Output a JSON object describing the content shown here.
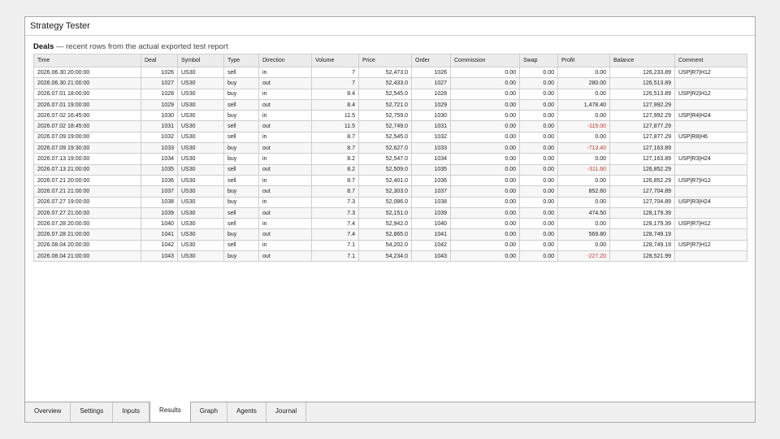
{
  "window": {
    "title": "Strategy Tester"
  },
  "section": {
    "title": "Deals",
    "description": " — recent rows from the actual exported test report"
  },
  "columns": [
    "Time",
    "Deal",
    "Symbol",
    "Type",
    "Direction",
    "Volume",
    "Price",
    "Order",
    "Commission",
    "Swap",
    "Profit",
    "Balance",
    "Comment"
  ],
  "rows": [
    [
      "2026.06.30 20:00:00",
      "1026",
      "US30",
      "sell",
      "in",
      "7",
      "52,473.0",
      "1026",
      "0.00",
      "0.00",
      "0.00",
      "126,233.89",
      "USP|R7|H12"
    ],
    [
      "2026.06.30 21:00:00",
      "1027",
      "US30",
      "buy",
      "out",
      "7",
      "52,433.0",
      "1027",
      "0.00",
      "0.00",
      "280.00",
      "126,513.89",
      ""
    ],
    [
      "2026.07.01 18:00:00",
      "1028",
      "US30",
      "buy",
      "in",
      "8.4",
      "52,545.0",
      "1028",
      "0.00",
      "0.00",
      "0.00",
      "126,513.89",
      "USP|R2|H12"
    ],
    [
      "2026.07.01 19:00:00",
      "1029",
      "US30",
      "sell",
      "out",
      "8.4",
      "52,721.0",
      "1029",
      "0.00",
      "0.00",
      "1,478.40",
      "127,992.29",
      ""
    ],
    [
      "2026.07.02 16:45:00",
      "1030",
      "US30",
      "buy",
      "in",
      "11.5",
      "52,759.0",
      "1030",
      "0.00",
      "0.00",
      "0.00",
      "127,992.29",
      "USP|R4|H24"
    ],
    [
      "2026.07.02 18:45:00",
      "1031",
      "US30",
      "sell",
      "out",
      "11.5",
      "52,749.0",
      "1031",
      "0.00",
      "0.00",
      "-115.00",
      "127,877.29",
      ""
    ],
    [
      "2026.07.09 19:00:00",
      "1032",
      "US30",
      "sell",
      "in",
      "8.7",
      "52,545.0",
      "1032",
      "0.00",
      "0.00",
      "0.00",
      "127,877.29",
      "USP|R8|H6"
    ],
    [
      "2026.07.09 19:30:00",
      "1033",
      "US30",
      "buy",
      "out",
      "8.7",
      "52,627.0",
      "1033",
      "0.00",
      "0.00",
      "-713.40",
      "127,163.89",
      ""
    ],
    [
      "2026.07.13 19:00:00",
      "1034",
      "US30",
      "buy",
      "in",
      "8.2",
      "52,547.0",
      "1034",
      "0.00",
      "0.00",
      "0.00",
      "127,163.89",
      "USP|R3|H24"
    ],
    [
      "2026.07.13 21:00:00",
      "1035",
      "US30",
      "sell",
      "out",
      "8.2",
      "52,509.0",
      "1035",
      "0.00",
      "0.00",
      "-311.60",
      "126,852.29",
      ""
    ],
    [
      "2026.07.21 20:00:00",
      "1036",
      "US30",
      "sell",
      "in",
      "8.7",
      "52,401.0",
      "1036",
      "0.00",
      "0.00",
      "0.00",
      "126,852.29",
      "USP|R7|H12"
    ],
    [
      "2026.07.21 21:00:00",
      "1037",
      "US30",
      "buy",
      "out",
      "8.7",
      "52,303.0",
      "1037",
      "0.00",
      "0.00",
      "852.60",
      "127,704.89",
      ""
    ],
    [
      "2026.07.27 19:00:00",
      "1038",
      "US30",
      "buy",
      "in",
      "7.3",
      "52,086.0",
      "1038",
      "0.00",
      "0.00",
      "0.00",
      "127,704.89",
      "USP|R3|H24"
    ],
    [
      "2026.07.27 21:00:00",
      "1039",
      "US30",
      "sell",
      "out",
      "7.3",
      "52,151.0",
      "1039",
      "0.00",
      "0.00",
      "474.50",
      "128,179.39",
      ""
    ],
    [
      "2026.07.28 20:00:00",
      "1040",
      "US30",
      "sell",
      "in",
      "7.4",
      "52,942.0",
      "1040",
      "0.00",
      "0.00",
      "0.00",
      "128,179.39",
      "USP|R7|H12"
    ],
    [
      "2026.07.28 21:00:00",
      "1041",
      "US30",
      "buy",
      "out",
      "7.4",
      "52,865.0",
      "1041",
      "0.00",
      "0.00",
      "569.80",
      "128,749.19",
      ""
    ],
    [
      "2026.08.04 20:00:00",
      "1042",
      "US30",
      "sell",
      "in",
      "7.1",
      "54,202.0",
      "1042",
      "0.00",
      "0.00",
      "0.00",
      "128,749.19",
      "USP|R7|H12"
    ],
    [
      "2026.08.04 21:00:00",
      "1043",
      "US30",
      "buy",
      "out",
      "7.1",
      "54,234.0",
      "1043",
      "0.00",
      "0.00",
      "-227.20",
      "128,521.99",
      ""
    ]
  ],
  "tabs": [
    {
      "label": "Overview",
      "active": false
    },
    {
      "label": "Settings",
      "active": false
    },
    {
      "label": "Inputs",
      "active": false
    },
    {
      "label": "Results",
      "active": true
    },
    {
      "label": "Graph",
      "active": false
    },
    {
      "label": "Agents",
      "active": false
    },
    {
      "label": "Journal",
      "active": false
    }
  ],
  "colors": {
    "negative_profit": "#c0392b",
    "window_border": "#a9a9a9",
    "header_bg": "#ececec"
  }
}
